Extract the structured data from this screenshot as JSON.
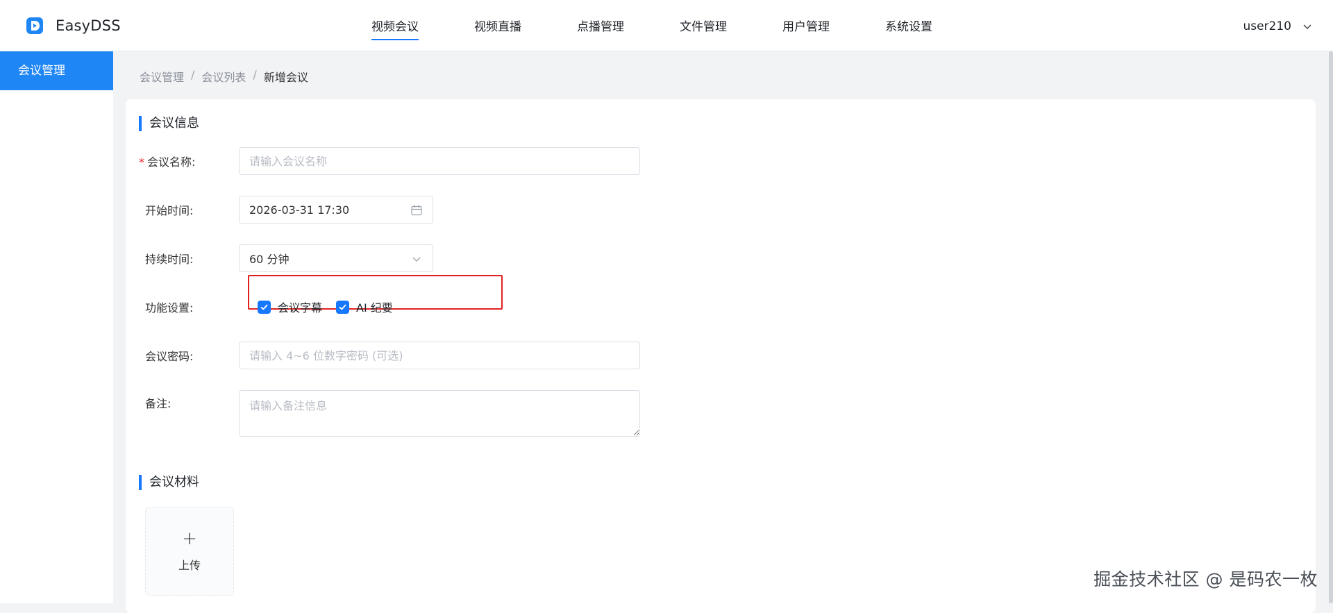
{
  "app": {
    "name": "EasyDSS"
  },
  "nav": {
    "items": [
      {
        "label": "视频会议",
        "active": true
      },
      {
        "label": "视频直播"
      },
      {
        "label": "点播管理"
      },
      {
        "label": "文件管理"
      },
      {
        "label": "用户管理"
      },
      {
        "label": "系统设置"
      }
    ]
  },
  "user": {
    "name": "user210"
  },
  "sidebar": {
    "items": [
      {
        "label": "会议管理",
        "active": true
      }
    ]
  },
  "breadcrumb": {
    "items": [
      "会议管理",
      "会议列表",
      "新增会议"
    ],
    "separator": "/"
  },
  "form": {
    "section_info": "会议信息",
    "name": {
      "label": "会议名称:",
      "placeholder": "请输入会议名称",
      "required_mark": "*"
    },
    "start": {
      "label": "开始时间:",
      "value": "2026-03-31 17:30"
    },
    "duration": {
      "label": "持续时间:",
      "value": "60 分钟"
    },
    "features": {
      "label": "功能设置:",
      "options": [
        {
          "label": "会议字幕",
          "checked": true
        },
        {
          "label": "AI 纪要",
          "checked": true
        }
      ]
    },
    "password": {
      "label": "会议密码:",
      "placeholder": "请输入 4~6 位数字密码 (可选)"
    },
    "notes": {
      "label": "备注:",
      "placeholder": "请输入备注信息"
    },
    "section_materials": "会议材料",
    "upload": {
      "plus": "+",
      "label": "上传"
    }
  },
  "watermark": "掘金技术社区 @ 是码农一枚",
  "colors": {
    "accent": "#1677ff",
    "sidebar_active": "#1f86f5",
    "highlight": "#e02020"
  }
}
